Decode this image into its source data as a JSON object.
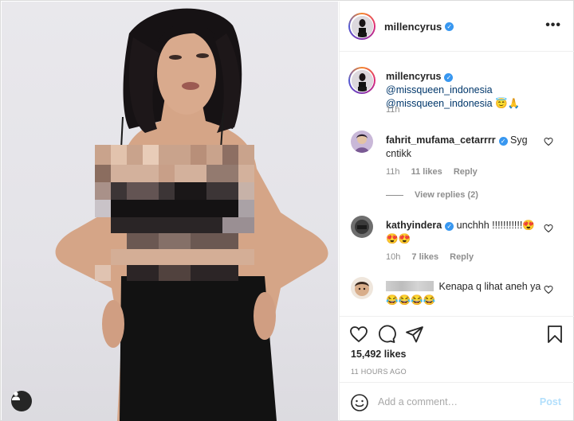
{
  "post": {
    "username": "millencyrus",
    "verified_mark": "✓",
    "more_icon_text": "•••",
    "caption_user": "millencyrus",
    "caption_text_1": "@missqueen_indonesia",
    "caption_text_2": "@missqueen_indonesia 😇🙏",
    "caption_time": "11h",
    "likes": "15,492 likes",
    "time_ago": "11 HOURS AGO"
  },
  "comments": [
    {
      "user": "fahrit_mufama_cetarrrr",
      "text": "Syg cntikk",
      "time": "11h",
      "likes": "11 likes",
      "reply": "Reply",
      "view_replies": "View replies (2)"
    },
    {
      "user": "kathyindera",
      "text": "unchhh !!!!!!!!!!!😍😍😍",
      "time": "10h",
      "likes": "7 likes",
      "reply": "Reply"
    },
    {
      "user": "",
      "text": "Kenapa q lihat aneh ya 😂😂😂😂"
    }
  ],
  "comment_box": {
    "placeholder": "Add a comment…",
    "post_label": "Post"
  },
  "icons": {
    "more": "more-options-icon",
    "like": "heart-icon",
    "comment": "comment-bubble-icon",
    "share": "paper-plane-icon",
    "save": "bookmark-icon",
    "emoji": "smiley-icon",
    "tag": "user-tag-icon"
  },
  "colors": {
    "verified": "#3897f0",
    "mention": "#00376b",
    "muted": "#8e8e8e",
    "post_disabled": "#b2dffc"
  }
}
